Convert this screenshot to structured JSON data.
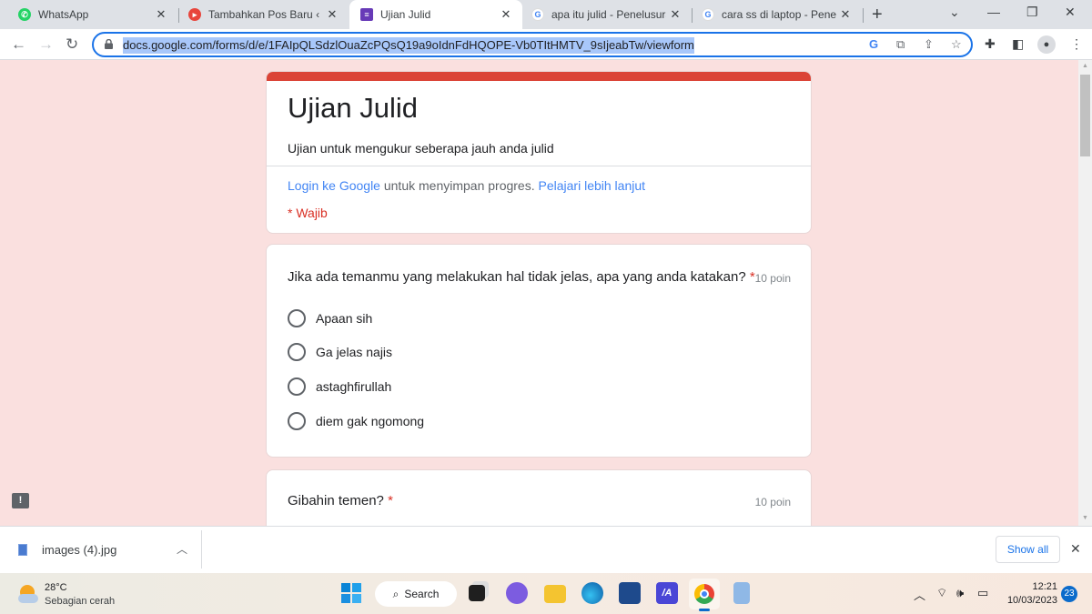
{
  "browser": {
    "tabs": [
      {
        "label": "WhatsApp",
        "icon": "whatsapp-icon",
        "color": "#25d366"
      },
      {
        "label": "Tambahkan Pos Baru ‹ Cia",
        "icon": "blog-icon",
        "color": "#e8453c"
      },
      {
        "label": "Ujian Julid",
        "icon": "google-forms-icon",
        "color": "#673ab7",
        "active": true
      },
      {
        "label": "apa itu julid - Penelusuran",
        "icon": "google-icon",
        "color": "#4285f4"
      },
      {
        "label": "cara ss di laptop - Penelusuran",
        "icon": "google-icon",
        "color": "#4285f4"
      }
    ],
    "new_tab": "+",
    "url": "docs.google.com/forms/d/e/1FAIpQLSdzlOuaZcPQsQ19a9oIdnFdHQOPE-Vb0TItHMTV_9sIjeabTw/viewform"
  },
  "form": {
    "accent": "#db4437",
    "title": "Ujian Julid",
    "description": "Ujian untuk mengukur seberapa jauh anda julid",
    "login_link": "Login ke Google",
    "login_text": " untuk menyimpan progres. ",
    "learn_more": "Pelajari lebih lanjut",
    "required_note": "* Wajib",
    "questions": [
      {
        "title": "Jika ada temanmu yang melakukan hal tidak jelas, apa yang anda katakan?",
        "required": "*",
        "points": "10 poin",
        "options": [
          "Apaan sih",
          "Ga jelas najis",
          "astaghfirullah",
          "diem gak ngomong"
        ]
      },
      {
        "title": "Gibahin temen?",
        "required": "*",
        "points": "10 poin"
      }
    ]
  },
  "downloads": {
    "file": "images (4).jpg",
    "show_all": "Show all"
  },
  "taskbar": {
    "temperature": "28°C",
    "weather": "Sebagian cerah",
    "search": "Search",
    "time": "12:21",
    "date": "10/03/2023",
    "notifications": "23"
  }
}
